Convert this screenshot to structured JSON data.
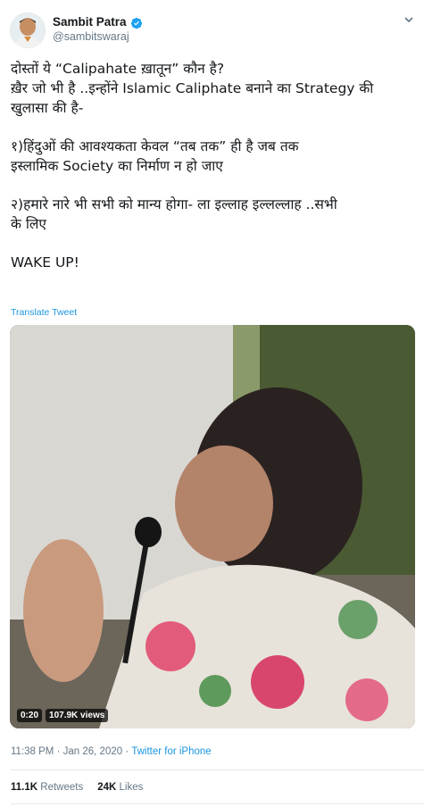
{
  "author": {
    "display_name": "Sambit Patra",
    "handle": "@sambitswaraj",
    "verified": true
  },
  "tweet": {
    "paragraphs": [
      [
        "दोस्तों ये “Calipahate ख़ातून” कौन है?",
        "ख़ैर जो भी है ..इन्होंने Islamic Caliphate बनाने का Strategy की",
        "खुलासा की है-"
      ],
      [
        "१)हिंदुओं की आवश्यकता केवल “तब तक” ही है जब तक",
        "इस्लामिक Society का निर्माण न हो जाए"
      ],
      [
        "२)हमारे नारे भी सभी को मान्य होगा- ला इल्लाह इल्लल्लाह ..सभी",
        "के लिए"
      ],
      [
        "WAKE UP!"
      ]
    ],
    "translate_label": "Translate Tweet"
  },
  "media": {
    "type": "video",
    "duration": "0:20",
    "views": "107.9K views"
  },
  "meta": {
    "time": "11:38 PM",
    "separator": "·",
    "date": "Jan 26, 2020",
    "source": "Twitter for iPhone"
  },
  "stats": {
    "retweets_count": "11.1K",
    "retweets_label": "Retweets",
    "likes_count": "24K",
    "likes_label": "Likes"
  },
  "colors": {
    "link_blue": "#1b95e0",
    "secondary_text": "#657786",
    "verified_blue": "#1da1f2"
  },
  "icons": [
    "verified-badge-icon",
    "chevron-down-icon"
  ]
}
